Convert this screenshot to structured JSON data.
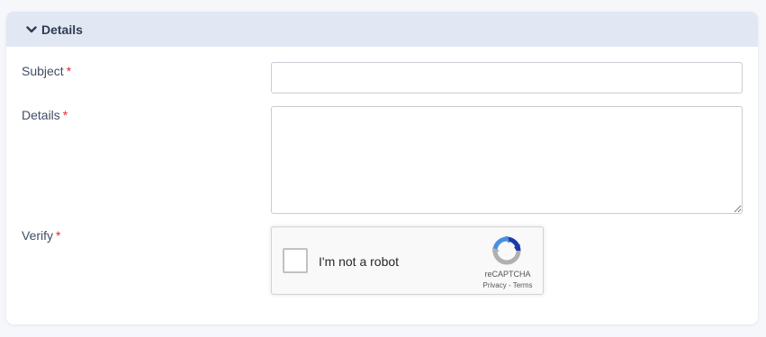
{
  "section": {
    "title": "Details",
    "collapse_icon": "chevron-down-icon"
  },
  "fields": {
    "subject": {
      "label": "Subject",
      "required_mark": "*",
      "value": "",
      "placeholder": ""
    },
    "details": {
      "label": "Details",
      "required_mark": "*",
      "value": "",
      "placeholder": ""
    },
    "verify": {
      "label": "Verify",
      "required_mark": "*"
    }
  },
  "recaptcha": {
    "checkbox_label": "I'm not a robot",
    "brand": "reCAPTCHA",
    "privacy_link": "Privacy",
    "separator": " - ",
    "terms_link": "Terms",
    "logo_icon": "recaptcha-logo-icon"
  },
  "colors": {
    "header_bg": "#e1e7f3",
    "required": "#e02b36",
    "label_text": "#414c63"
  }
}
